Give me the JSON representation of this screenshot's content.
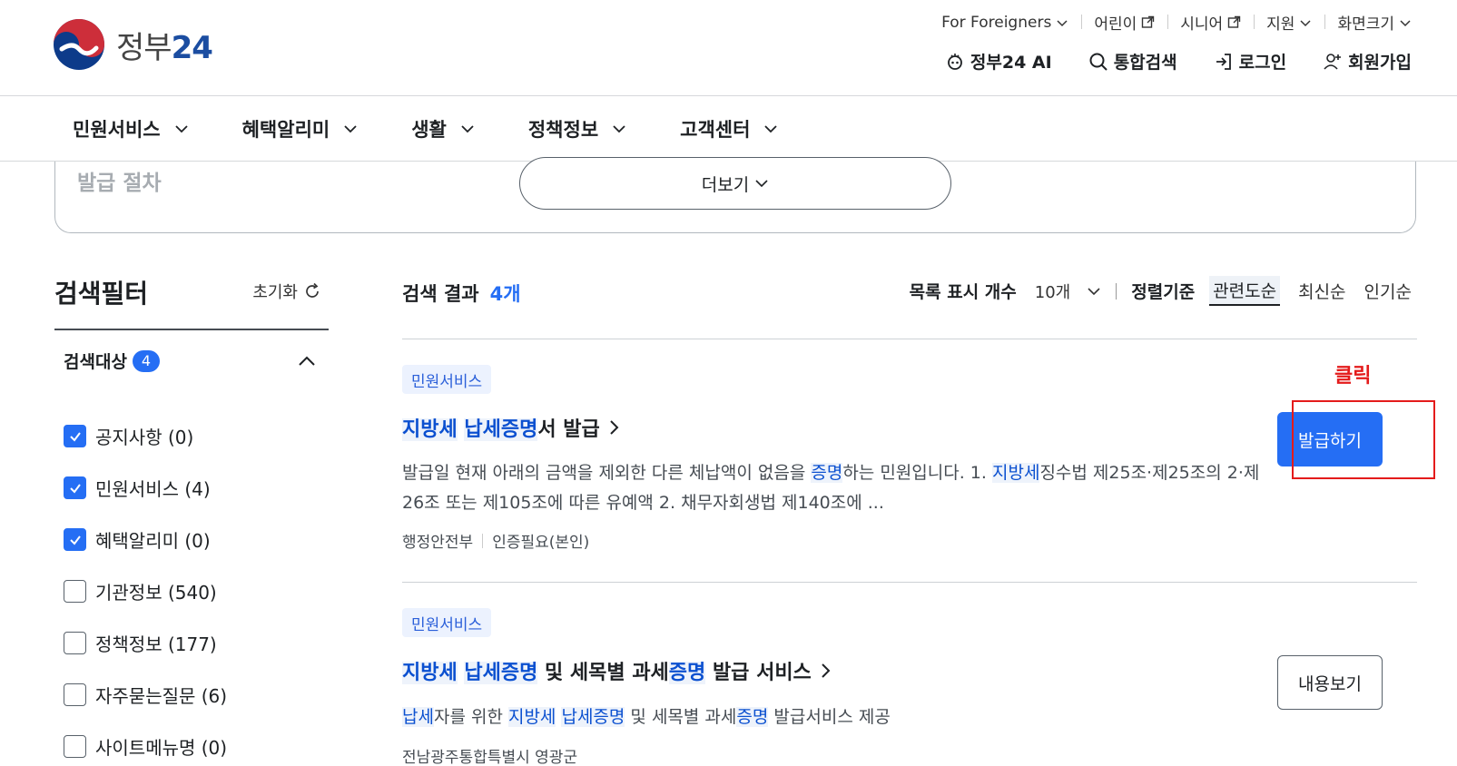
{
  "header": {
    "logo_text": "정부",
    "logo_num": "24",
    "utility": [
      {
        "label": "For Foreigners",
        "icon": "chevron-down-icon"
      },
      {
        "label": "어린이",
        "icon": "external-link-icon"
      },
      {
        "label": "시니어",
        "icon": "external-link-icon"
      },
      {
        "label": "지원",
        "icon": "chevron-down-icon"
      },
      {
        "label": "화면크기",
        "icon": "chevron-down-icon"
      }
    ],
    "links": [
      {
        "label": "정부24 AI",
        "icon": "ai-icon"
      },
      {
        "label": "통합검색",
        "icon": "search-icon"
      },
      {
        "label": "로그인",
        "icon": "login-icon"
      },
      {
        "label": "회원가입",
        "icon": "user-plus-icon"
      }
    ]
  },
  "gnb": [
    "민원서비스",
    "혜택알리미",
    "생활",
    "정책정보",
    "고객센터"
  ],
  "procedure": {
    "title": "발급 절차",
    "more_label": "더보기"
  },
  "filter": {
    "title": "검색필터",
    "reset_label": "초기화",
    "target_label": "검색대상",
    "target_count": "4",
    "items": [
      {
        "label": "공지사항 (0)",
        "checked": true
      },
      {
        "label": "민원서비스 (4)",
        "checked": true
      },
      {
        "label": "혜택알리미 (0)",
        "checked": true
      },
      {
        "label": "기관정보 (540)",
        "checked": false
      },
      {
        "label": "정책정보 (177)",
        "checked": false
      },
      {
        "label": "자주묻는질문 (6)",
        "checked": false
      },
      {
        "label": "사이트메뉴명 (0)",
        "checked": false
      }
    ]
  },
  "results": {
    "title": "검색 결과",
    "count": "4개",
    "perpage_label": "목록 표시 개수",
    "perpage_value": "10개",
    "sort_label": "정렬기준",
    "sort_options": [
      "관련도순",
      "최신순",
      "인기순"
    ],
    "items": [
      {
        "tag": "민원서비스",
        "title_parts": [
          {
            "text": "지방세",
            "hl": true
          },
          {
            "text": " ",
            "hl": false
          },
          {
            "text": "납세증명",
            "hl": true
          },
          {
            "text": "서 발급",
            "hl": false
          }
        ],
        "desc_parts": [
          {
            "text": "발급일 현재 아래의 금액을 제외한 다른 체납액이 없음을 ",
            "hl": false
          },
          {
            "text": "증명",
            "hl": true
          },
          {
            "text": "하는 민원입니다. 1. ",
            "hl": false
          },
          {
            "text": "지방세",
            "hl": true
          },
          {
            "text": "징수법 제25조·제25조의 2·제26조 또는 제105조에 따른 유예액 2. 채무자회생법 제140조에 ...",
            "hl": false
          }
        ],
        "meta": [
          "행정안전부",
          "인증필요(본인)"
        ],
        "button": "발급하기"
      },
      {
        "tag": "민원서비스",
        "title_parts": [
          {
            "text": "지방세",
            "hl": true
          },
          {
            "text": " ",
            "hl": false
          },
          {
            "text": "납세증명",
            "hl": true
          },
          {
            "text": " 및 세목별 과세",
            "hl": false
          },
          {
            "text": "증명",
            "hl": true
          },
          {
            "text": " 발급 서비스",
            "hl": false
          }
        ],
        "desc_parts": [
          {
            "text": "납세",
            "hl": true
          },
          {
            "text": "자를 위한 ",
            "hl": false
          },
          {
            "text": "지방세",
            "hl": true
          },
          {
            "text": " ",
            "hl": false
          },
          {
            "text": "납세증명",
            "hl": true
          },
          {
            "text": " 및 세목별 과세",
            "hl": false
          },
          {
            "text": "증명",
            "hl": true
          },
          {
            "text": " 발급서비스 제공",
            "hl": false
          }
        ],
        "meta": [
          "전남광주통합특별시 영광군"
        ],
        "button": "내용보기"
      }
    ]
  },
  "annotation": {
    "label": "클릭",
    "color": "#e41b1b"
  },
  "colors": {
    "primary": "#256ef4",
    "highlight": "#0b50d0",
    "tag_bg": "#ecf2fe"
  }
}
